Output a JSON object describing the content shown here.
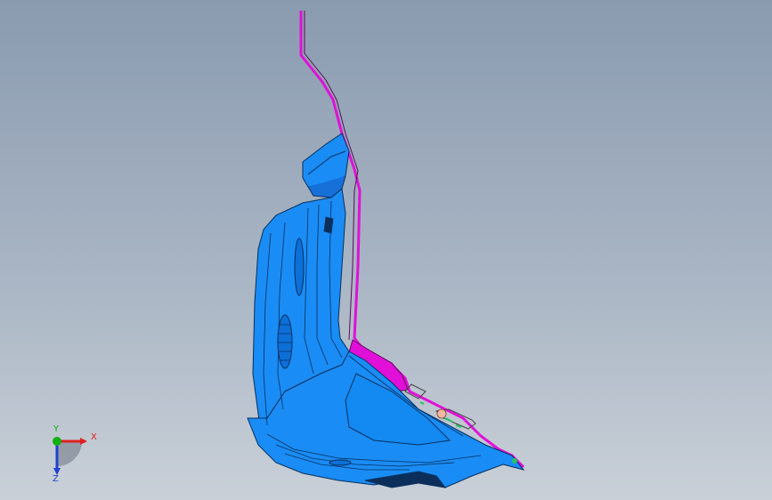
{
  "viewport": {
    "background_top": "#8a9bb0",
    "background_bottom": "#c9d0d8"
  },
  "model": {
    "body_color": "#1a8cf5",
    "body_shadow_color": "#0b5fc4",
    "section_color": "#e010d8",
    "accent_color": "#22c55e"
  },
  "triad": {
    "x_label": "X",
    "y_label": "Y",
    "z_label": "Z",
    "x_color": "#e02020",
    "y_color": "#10b010",
    "z_color": "#2040d0"
  }
}
